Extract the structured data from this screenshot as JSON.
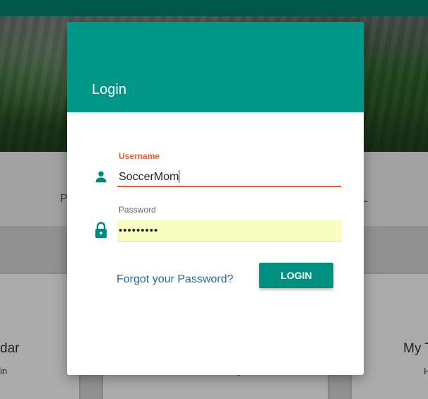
{
  "background": {
    "nav_left_text": "P",
    "nav_right_text": "L",
    "cards": [
      {
        "title": "dar",
        "sub": "in"
      },
      {
        "title": "",
        "sub": "y"
      },
      {
        "title": "My T",
        "sub": "H"
      }
    ]
  },
  "dialog": {
    "title": "Login",
    "username": {
      "label": "Username",
      "value": "SoccerMom",
      "icon": "person-icon"
    },
    "password": {
      "label": "Password",
      "value": "•••••••••",
      "icon": "lock-icon"
    },
    "forgot_link": "Forgot your Password?",
    "login_button": "LOGIN"
  },
  "colors": {
    "header": "#009688",
    "accent_active": "#ee5b24",
    "button": "#00907f",
    "link": "#1e6aa6",
    "autofill_bg": "#fafdc0"
  }
}
